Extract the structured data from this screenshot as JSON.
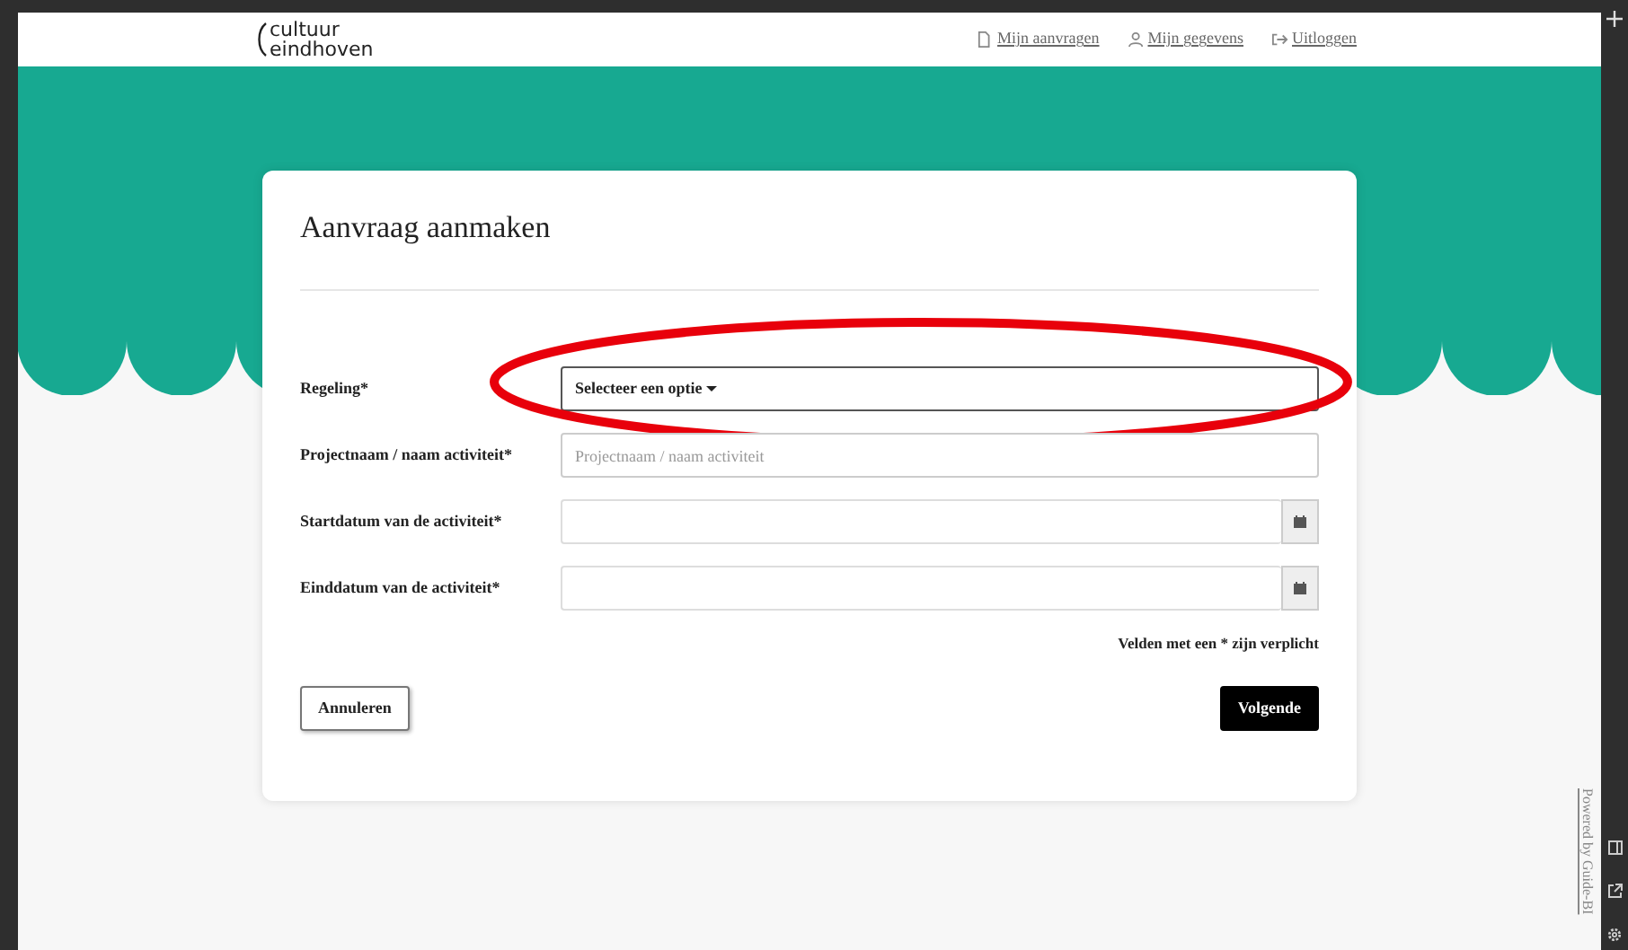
{
  "header": {
    "logo": [
      "cultuur",
      "eindhoven"
    ],
    "nav": [
      {
        "kind": "document",
        "label": "Mijn aanvragen"
      },
      {
        "kind": "person",
        "label": "Mijn gegevens"
      },
      {
        "kind": "logout",
        "label": "Uitloggen"
      }
    ]
  },
  "form": {
    "title": "Aanvraag aanmaken",
    "fields": [
      {
        "kind": "select",
        "label": "Regeling*",
        "value": "Selecteer een optie",
        "annotated": true
      },
      {
        "kind": "text",
        "label": "Projectnaam / naam activiteit*",
        "placeholder": "Projectnaam / naam activiteit",
        "annotated": false
      },
      {
        "kind": "date",
        "label": "Startdatum van de activiteit*",
        "annotated": false
      },
      {
        "kind": "date",
        "label": "Einddatum van de activiteit*",
        "annotated": false
      }
    ],
    "required_note": "Velden met een * zijn verplicht",
    "buttons": [
      {
        "kind": "secondary",
        "label": "Annuleren"
      },
      {
        "kind": "primary",
        "label": "Volgende"
      }
    ]
  },
  "powered_by": "Powered by Guide-BI"
}
